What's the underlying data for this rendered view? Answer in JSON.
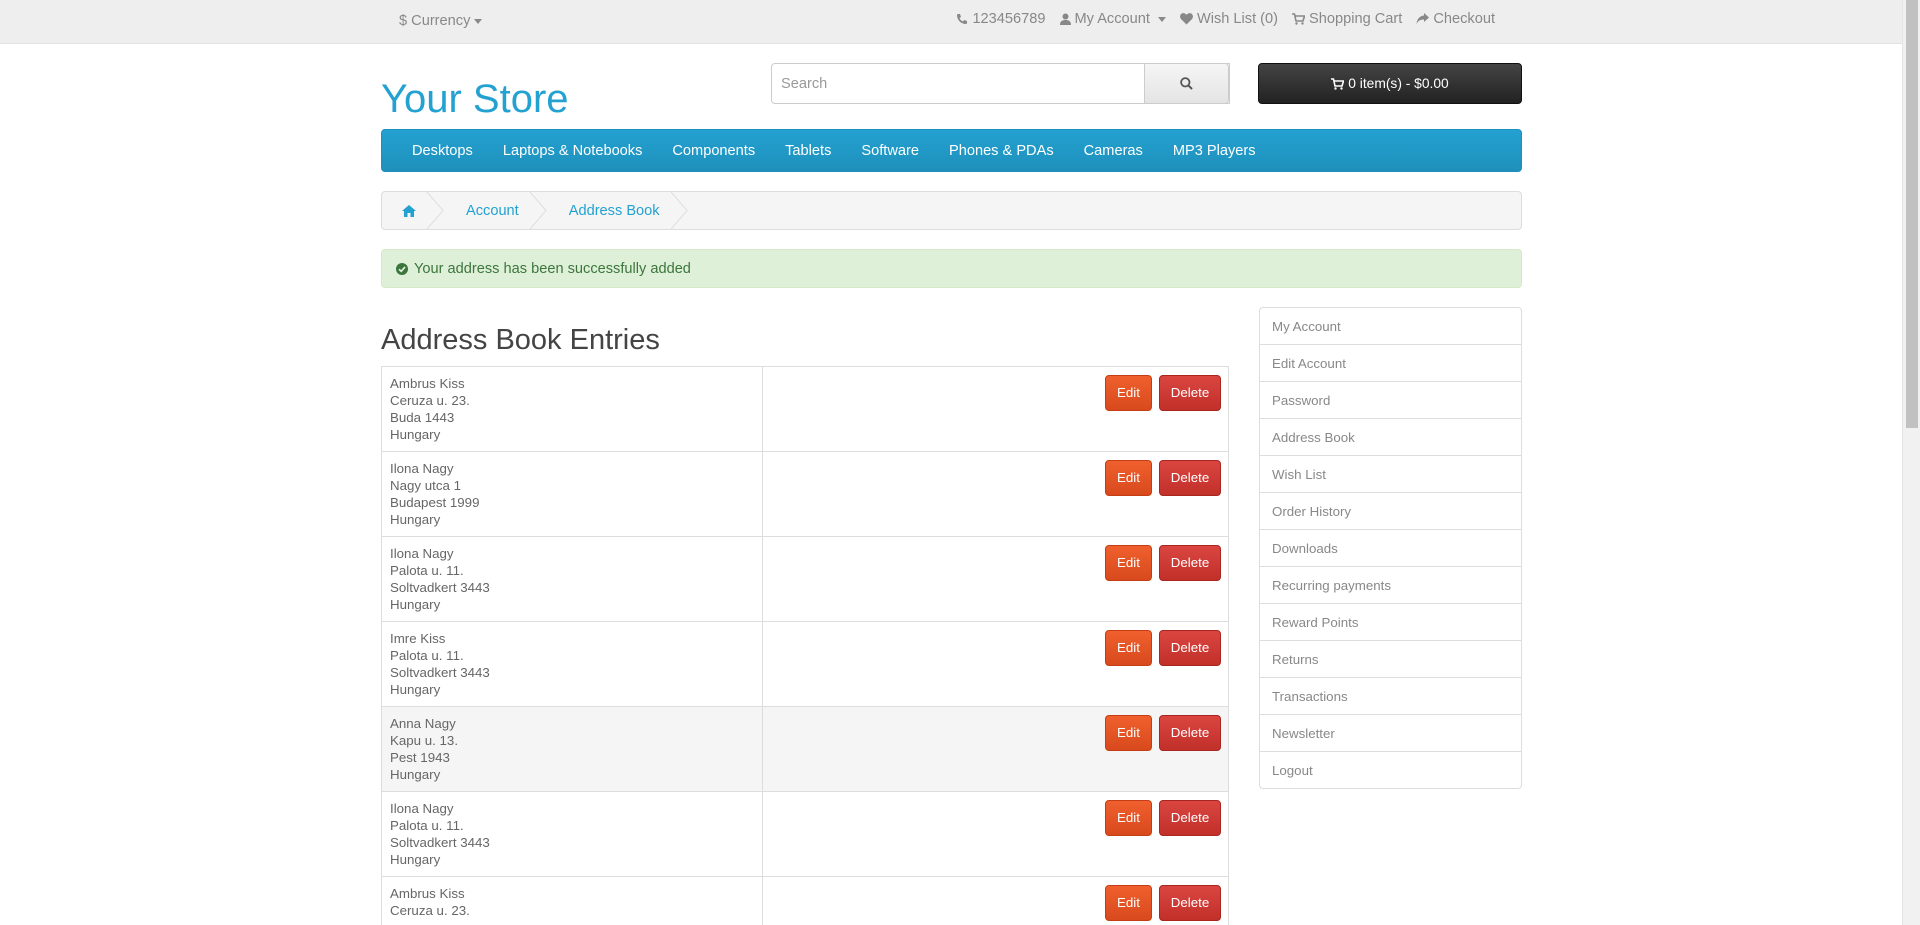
{
  "topbar": {
    "currency": "$ Currency",
    "phone": "123456789",
    "my_account": "My Account",
    "wishlist": "Wish List (0)",
    "shopping_cart": "Shopping Cart",
    "checkout": "Checkout"
  },
  "header": {
    "logo": "Your Store",
    "search_placeholder": "Search",
    "cart": "0 item(s) - $0.00"
  },
  "menu": [
    "Desktops",
    "Laptops & Notebooks",
    "Components",
    "Tablets",
    "Software",
    "Phones & PDAs",
    "Cameras",
    "MP3 Players"
  ],
  "breadcrumb": [
    "Account",
    "Address Book"
  ],
  "alert": "Your address has been successfully added",
  "page_title": "Address Book Entries",
  "buttons": {
    "edit": "Edit",
    "delete": "Delete"
  },
  "addresses": [
    [
      "Ambrus Kiss",
      "Ceruza u. 23.",
      "Buda 1443",
      "Hungary"
    ],
    [
      "Ilona Nagy",
      "Nagy utca 1",
      "Budapest 1999",
      "Hungary"
    ],
    [
      "Ilona Nagy",
      "Palota u. 11.",
      "Soltvadkert 3443",
      "Hungary"
    ],
    [
      "Imre Kiss",
      "Palota u. 11.",
      "Soltvadkert 3443",
      "Hungary"
    ],
    [
      "Anna Nagy",
      "Kapu u. 13.",
      "Pest 1943",
      "Hungary"
    ],
    [
      "Ilona Nagy",
      "Palota u. 11.",
      "Soltvadkert 3443",
      "Hungary"
    ],
    [
      "Ambrus Kiss",
      "Ceruza u. 23.",
      "",
      ""
    ]
  ],
  "sidebar": [
    "My Account",
    "Edit Account",
    "Password",
    "Address Book",
    "Wish List",
    "Order History",
    "Downloads",
    "Recurring payments",
    "Reward Points",
    "Returns",
    "Transactions",
    "Newsletter",
    "Logout"
  ],
  "colors": {
    "brand": "#23a1d1",
    "edit": "#e4572e",
    "delete": "#d43f3a",
    "alert_bg": "#dff0d8"
  }
}
